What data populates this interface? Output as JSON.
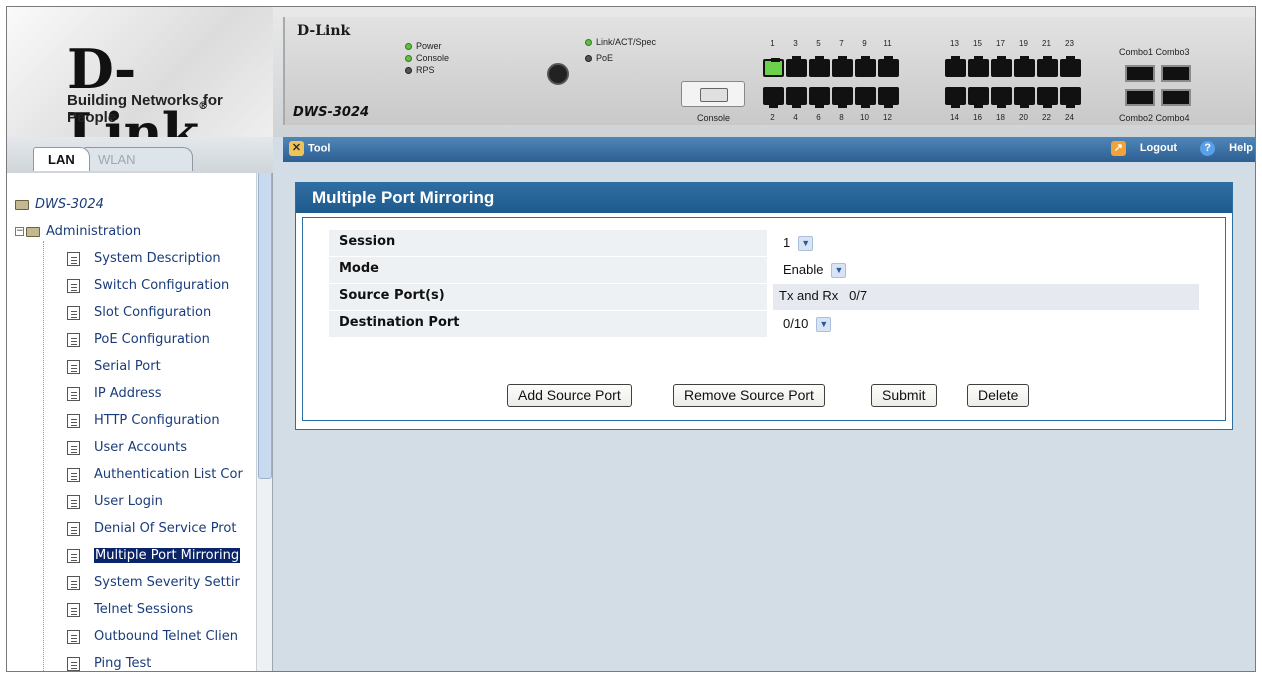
{
  "brand": {
    "name": "D-Link",
    "registered": "®",
    "tagline": "Building Networks for People"
  },
  "device": {
    "logo": "D-Link",
    "model": "DWS-3024",
    "leds_left": [
      "Power",
      "Console",
      "RPS"
    ],
    "leds_right": [
      "Link/ACT/Spec",
      "PoE"
    ],
    "console_label": "Console",
    "top_ports": [
      "1",
      "3",
      "5",
      "7",
      "9",
      "11",
      "13",
      "15",
      "17",
      "19",
      "21",
      "23"
    ],
    "bottom_ports": [
      "2",
      "4",
      "6",
      "8",
      "10",
      "12",
      "14",
      "16",
      "18",
      "20",
      "22",
      "24"
    ],
    "combo_top": "Combo1 Combo3",
    "combo_bottom": "Combo2 Combo4"
  },
  "tabs": {
    "lan": "LAN",
    "wlan": "WLAN"
  },
  "toolbar": {
    "tool_label": "Tool",
    "logout_label": "Logout",
    "help_label": "Help"
  },
  "sidebar": {
    "root": "DWS-3024",
    "admin": "Administration",
    "items": [
      "System Description",
      "Switch Configuration",
      "Slot Configuration",
      "PoE Configuration",
      "Serial Port",
      "IP Address",
      "HTTP Configuration",
      "User Accounts",
      "Authentication List Cor",
      "User Login",
      "Denial Of Service Prot",
      "Multiple Port Mirroring",
      "System Severity Settir",
      "Telnet Sessions",
      "Outbound Telnet Clien",
      "Ping Test"
    ],
    "selected_index": 11
  },
  "panel": {
    "title": "Multiple Port Mirroring",
    "rows": [
      {
        "label": "Session",
        "value": "1"
      },
      {
        "label": "Mode",
        "value": "Enable"
      },
      {
        "label": "Source Port(s)",
        "value": "Tx and Rx   0/7"
      },
      {
        "label": "Destination Port",
        "value": "0/10"
      }
    ],
    "buttons": {
      "add": "Add Source Port",
      "remove": "Remove Source Port",
      "submit": "Submit",
      "delete": "Delete"
    }
  },
  "colors": {
    "accent": "#2f6ea3",
    "toolbar": "#3d73a8",
    "selected": "#0a246a",
    "background": "#d3dde6"
  }
}
